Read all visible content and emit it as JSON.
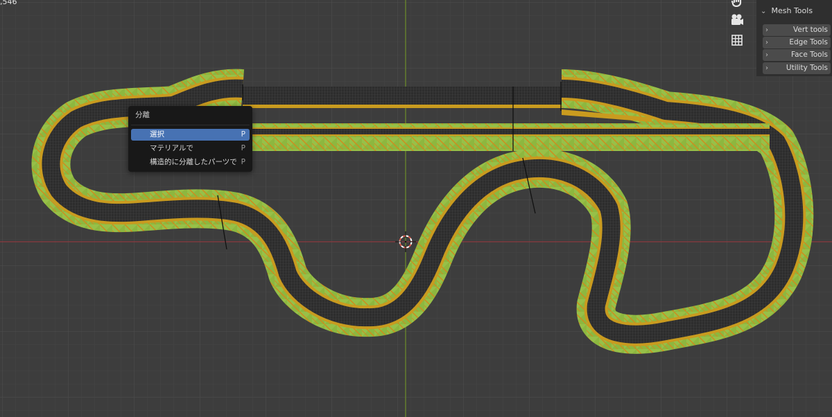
{
  "viewport": {
    "stat_text": ",546",
    "colors": {
      "background": "#3d3d3d",
      "grid_minor": "#444444",
      "grid_major": "#4e4e4e",
      "x_axis": "#8c3a3f",
      "y_axis": "#6f8f2a",
      "road": "#2f2f2f",
      "curb_green": "#8db73f",
      "curb_orange": "#d18a1c",
      "stripe_yellow": "#c99b1f"
    },
    "nav_icons": [
      "hand-pan-icon",
      "camera-icon",
      "grid-view-icon"
    ]
  },
  "sidebar": {
    "title": "Mesh Tools",
    "items": [
      {
        "label": "Vert tools"
      },
      {
        "label": "Edge Tools"
      },
      {
        "label": "Face Tools"
      },
      {
        "label": "Utility Tools"
      }
    ]
  },
  "context_menu": {
    "title": "分離",
    "items": [
      {
        "label": "選択",
        "shortcut": "P",
        "active": true
      },
      {
        "label": "マテリアルで",
        "shortcut": "P",
        "active": false
      },
      {
        "label": "構造的に分離したパーツで",
        "shortcut": "P",
        "active": false
      }
    ]
  }
}
